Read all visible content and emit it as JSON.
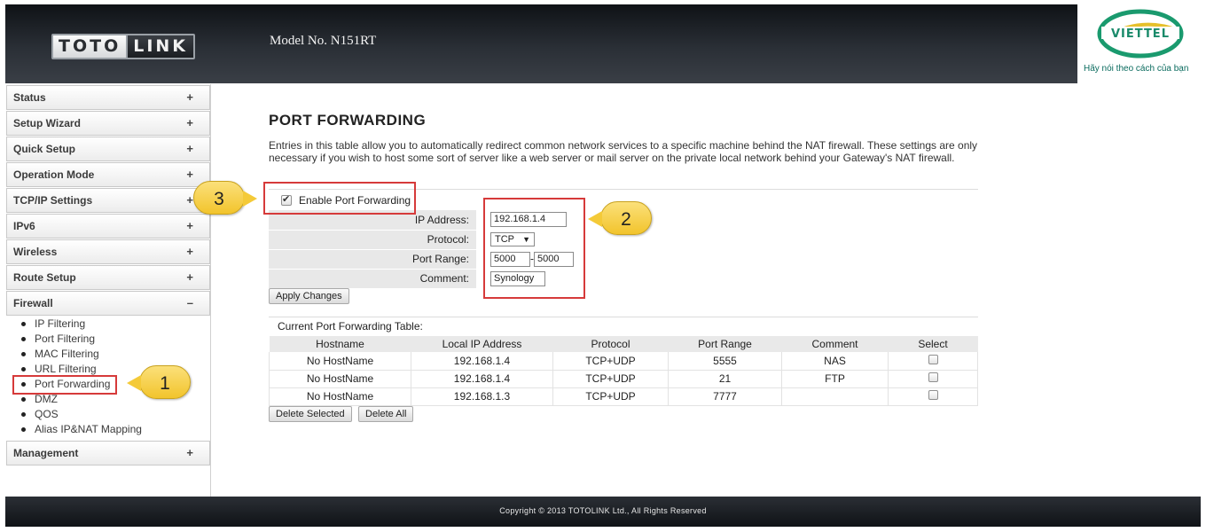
{
  "header": {
    "logo_part1": "TOTO",
    "logo_part2": "LINK",
    "model": "Model No. N151RT",
    "brand_name": "VIETTEL",
    "brand_slogan": "Hãy nói theo cách của bạn"
  },
  "sidebar": {
    "items": [
      {
        "label": "Status",
        "toggle": "+"
      },
      {
        "label": "Setup Wizard",
        "toggle": "+"
      },
      {
        "label": "Quick Setup",
        "toggle": "+"
      },
      {
        "label": "Operation Mode",
        "toggle": "+"
      },
      {
        "label": "TCP/IP Settings",
        "toggle": "+"
      },
      {
        "label": "IPv6",
        "toggle": "+"
      },
      {
        "label": "Wireless",
        "toggle": "+"
      },
      {
        "label": "Route Setup",
        "toggle": "+"
      },
      {
        "label": "Firewall",
        "toggle": "–"
      },
      {
        "label": "Management",
        "toggle": "+"
      }
    ],
    "firewall_sub": [
      "IP Filtering",
      "Port Filtering",
      "MAC Filtering",
      "URL Filtering",
      "Port Forwarding",
      "DMZ",
      "QOS",
      "Alias IP&NAT Mapping"
    ]
  },
  "main": {
    "title": "PORT FORWARDING",
    "description": "Entries in this table allow you to automatically redirect common network services to a specific machine behind the NAT firewall. These settings are only necessary if you wish to host some sort of server like a web server or mail server on the private local network behind your Gateway's NAT firewall.",
    "enable_label": "Enable Port Forwarding",
    "enable_checked": true,
    "form": {
      "ip_label": "IP Address:",
      "ip_value": "192.168.1.4",
      "protocol_label": "Protocol:",
      "protocol_value": "TCP",
      "port_label": "Port Range:",
      "port_from": "5000",
      "port_sep": "-",
      "port_to": "5000",
      "comment_label": "Comment:",
      "comment_value": "Synology"
    },
    "apply_label": "Apply Changes",
    "table_caption": "Current Port Forwarding Table:",
    "table_headers": [
      "Hostname",
      "Local IP Address",
      "Protocol",
      "Port Range",
      "Comment",
      "Select"
    ],
    "table_rows": [
      [
        "No HostName",
        "192.168.1.4",
        "TCP+UDP",
        "5555",
        "NAS"
      ],
      [
        "No HostName",
        "192.168.1.4",
        "TCP+UDP",
        "21",
        "FTP"
      ],
      [
        "No HostName",
        "192.168.1.3",
        "TCP+UDP",
        "7777",
        ""
      ]
    ],
    "delete_selected_label": "Delete Selected",
    "delete_all_label": "Delete All"
  },
  "annotations": {
    "callout1": "1",
    "callout2": "2",
    "callout3": "3"
  },
  "footer": {
    "copyright": "Copyright © 2013 TOTOLINK Ltd.,   All Rights Reserved"
  },
  "colors": {
    "annotation_red": "#d63a3a",
    "callout_yellow": "#f2c42c",
    "brand_green": "#0a6b5e"
  }
}
